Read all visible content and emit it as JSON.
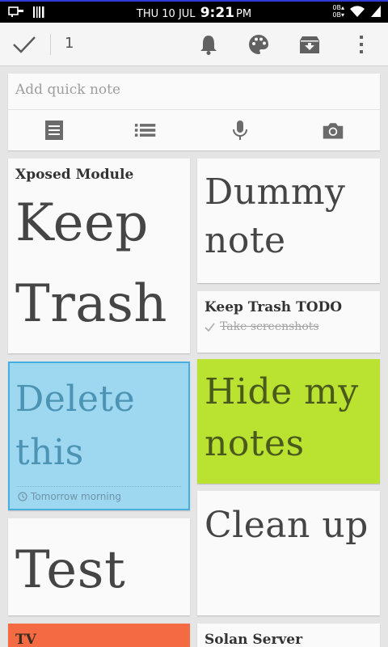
{
  "status_bar": {
    "date": "THU 10 JUL",
    "time": "9:21",
    "ampm": "PM",
    "data_up": "0B▴",
    "data_down": "0B▾"
  },
  "toolbar": {
    "selected_count": "1"
  },
  "quick_note": {
    "placeholder": "Add quick note"
  },
  "notes": [
    {
      "title": "Xposed Module",
      "body": "Keep Trash",
      "color": "#fafafa"
    },
    {
      "title": "",
      "body": "Dummy note",
      "color": "#fafafa"
    },
    {
      "title": "Keep Trash TODO",
      "checked_item": "Take screenshots",
      "color": "#fafafa"
    },
    {
      "title": "",
      "body": "Delete this",
      "reminder": "Tomorrow morning",
      "color": "#9dd7f0"
    },
    {
      "title": "",
      "body": "Hide my notes",
      "color": "#b9e231"
    },
    {
      "title": "",
      "body": "Test",
      "color": "#fafafa"
    },
    {
      "title": "",
      "body": "Clean up",
      "color": "#fafafa"
    },
    {
      "title": "TV",
      "color": "#f46a43"
    },
    {
      "title": "Solan Server",
      "color": "#fafafa"
    }
  ],
  "icons": [
    "check-icon",
    "bell-icon",
    "palette-icon",
    "archive-icon",
    "more-vert-icon",
    "text-note-icon",
    "list-note-icon",
    "mic-icon",
    "camera-icon",
    "clock-icon",
    "checkmark-icon"
  ]
}
